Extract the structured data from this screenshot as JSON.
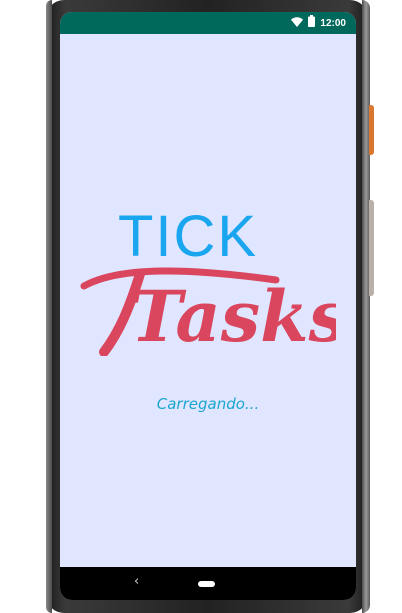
{
  "status_bar": {
    "time": "12:00",
    "icons": [
      "wifi-icon",
      "battery-icon"
    ],
    "background": "#00695c"
  },
  "splash": {
    "logo_top_text": "TICK",
    "logo_bottom_text": "Tasks",
    "logo_top_color": "#1aa6ee",
    "logo_bottom_color": "#d9465e",
    "loading_text": "Carregando...",
    "background": "#e0e6ff"
  },
  "nav_bar": {
    "back_glyph": "‹",
    "icons": [
      "back-icon",
      "home-pill-icon"
    ]
  }
}
